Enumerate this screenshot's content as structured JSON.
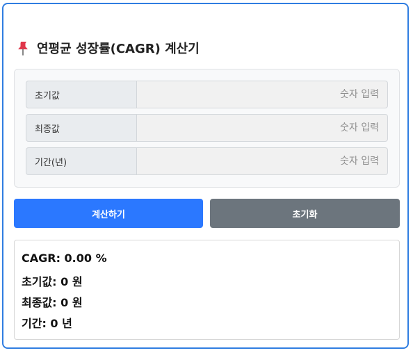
{
  "title": "연평균 성장률(CAGR) 계산기",
  "icons": {
    "title_icon": "pushpin-icon"
  },
  "colors": {
    "accent": "#2b78ff",
    "frame": "#2f7de1",
    "secondary": "#6c757d"
  },
  "form": {
    "fields": [
      {
        "label": "초기값",
        "placeholder": "숫자 입력",
        "value": ""
      },
      {
        "label": "최종값",
        "placeholder": "숫자 입력",
        "value": ""
      },
      {
        "label": "기간(년)",
        "placeholder": "숫자 입력",
        "value": ""
      }
    ]
  },
  "buttons": {
    "calculate": "계산하기",
    "reset": "초기화"
  },
  "result": {
    "cagr": "CAGR: 0.00 %",
    "initial": "초기값: 0 원",
    "final": "최종값: 0 원",
    "period": "기간: 0 년"
  }
}
